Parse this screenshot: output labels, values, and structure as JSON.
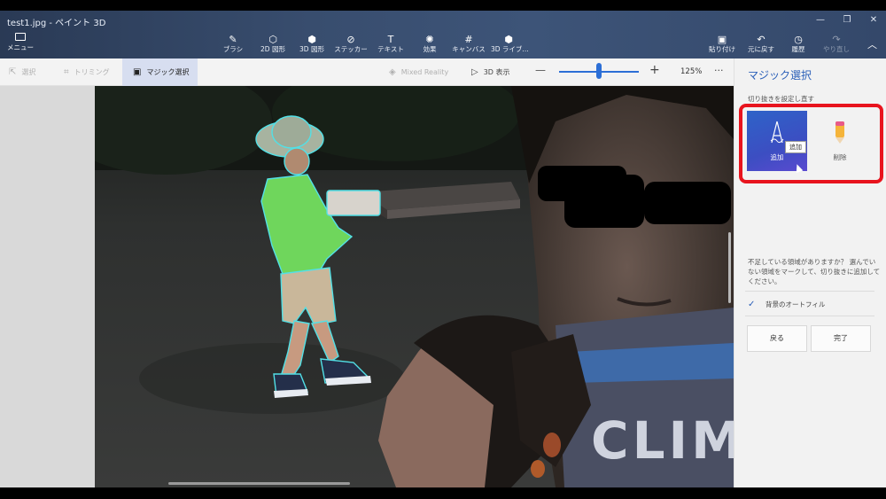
{
  "window": {
    "title": "test1.jpg - ペイント 3D"
  },
  "menu": {
    "label": "メニュー"
  },
  "tools": [
    {
      "id": "brush",
      "label": "ブラシ",
      "icon": "brush-icon",
      "glyph": "✎"
    },
    {
      "id": "shapes2d",
      "label": "2D 図形",
      "icon": "shapes-2d-icon",
      "glyph": "⬡"
    },
    {
      "id": "shapes3d",
      "label": "3D 図形",
      "icon": "cube-icon",
      "glyph": "⬢"
    },
    {
      "id": "stickers",
      "label": "ステッカー",
      "icon": "sticker-icon",
      "glyph": "⊘"
    },
    {
      "id": "text",
      "label": "テキスト",
      "icon": "text-icon",
      "glyph": "T"
    },
    {
      "id": "effects",
      "label": "効果",
      "icon": "effects-icon",
      "glyph": "✺"
    },
    {
      "id": "canvas",
      "label": "キャンバス",
      "icon": "canvas-icon",
      "glyph": "#"
    },
    {
      "id": "library3d",
      "label": "3D ライブ...",
      "icon": "library-3d-icon",
      "glyph": "⬢"
    }
  ],
  "right_tools": [
    {
      "id": "paste",
      "label": "貼り付け",
      "icon": "paste-icon",
      "glyph": "▣"
    },
    {
      "id": "undo",
      "label": "元に戻す",
      "icon": "undo-icon",
      "glyph": "↶"
    },
    {
      "id": "history",
      "label": "履歴",
      "icon": "history-icon",
      "glyph": "◷"
    },
    {
      "id": "redo",
      "label": "やり直し",
      "icon": "redo-icon",
      "glyph": "↷"
    }
  ],
  "toolbar2": {
    "select": "選択",
    "crop": "トリミング",
    "magic_select": "マジック選択",
    "mixed_reality": "Mixed Reality",
    "view_3d": "3D 表示",
    "zoom": "125%",
    "zoom_value": 0.5
  },
  "panel": {
    "title": "マジック選択",
    "subtitle": "切り抜きを設定し直す",
    "add_label": "追加",
    "delete_label": "削除",
    "tooltip": "追加",
    "message": "不足している領域がありますか？ 選んでいない領域をマークして、切り抜きに追加してください。",
    "autofill_label": "背景のオートフィル",
    "autofill_checked": true,
    "back_button": "戻る",
    "done_button": "完了"
  },
  "colors": {
    "accent": "#2a5fb8",
    "annotation": "#e8141e",
    "selection_outline": "#52e0e6"
  }
}
